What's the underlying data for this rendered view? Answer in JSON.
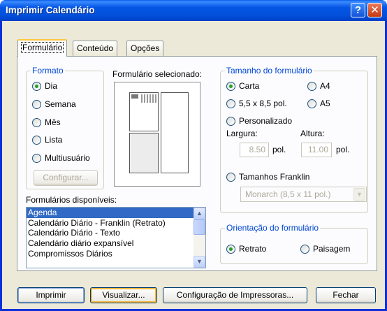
{
  "window": {
    "title": "Imprimir Calendário",
    "help_glyph": "?",
    "close_glyph": "✕"
  },
  "tabs": [
    {
      "label": "Formulário",
      "active": true
    },
    {
      "label": "Conteúdo",
      "active": false
    },
    {
      "label": "Opções",
      "active": false
    }
  ],
  "formato": {
    "legend": "Formato",
    "options": [
      {
        "label": "Dia",
        "selected": true
      },
      {
        "label": "Semana",
        "selected": false
      },
      {
        "label": "Mês",
        "selected": false
      },
      {
        "label": "Lista",
        "selected": false
      },
      {
        "label": "Multiusuário",
        "selected": false
      }
    ],
    "configure_button": "Configurar..."
  },
  "selected_form_label": "Formulário selecionado:",
  "forms_list": {
    "label": "Formulários disponíveis:",
    "items": [
      {
        "label": "Agenda",
        "selected": true
      },
      {
        "label": "Calendário Diário - Franklin (Retrato)",
        "selected": false
      },
      {
        "label": "Calendário Diário - Texto",
        "selected": false
      },
      {
        "label": "Calendário diário expansível",
        "selected": false
      },
      {
        "label": "Compromissos Diários",
        "selected": false
      }
    ]
  },
  "size": {
    "legend": "Tamanho do formulário",
    "carta": "Carta",
    "a4": "A4",
    "half_letter": "5,5 x 8,5 pol.",
    "a5": "A5",
    "custom": "Personalizado",
    "width_label": "Largura:",
    "width_value": "8.50",
    "width_unit": "pol.",
    "height_label": "Altura:",
    "height_value": "11.00",
    "height_unit": "pol.",
    "franklin": "Tamanhos Franklin",
    "franklin_select": "Monarch  (8,5 x 11 pol.)",
    "selected": "Carta"
  },
  "orientation": {
    "legend": "Orientação do formulário",
    "portrait": "Retrato",
    "landscape": "Paisagem",
    "selected": "Retrato"
  },
  "buttons": {
    "print": "Imprimir",
    "preview": "Visualizar...",
    "printer_setup": "Configuração de Impressoras...",
    "close": "Fechar"
  }
}
